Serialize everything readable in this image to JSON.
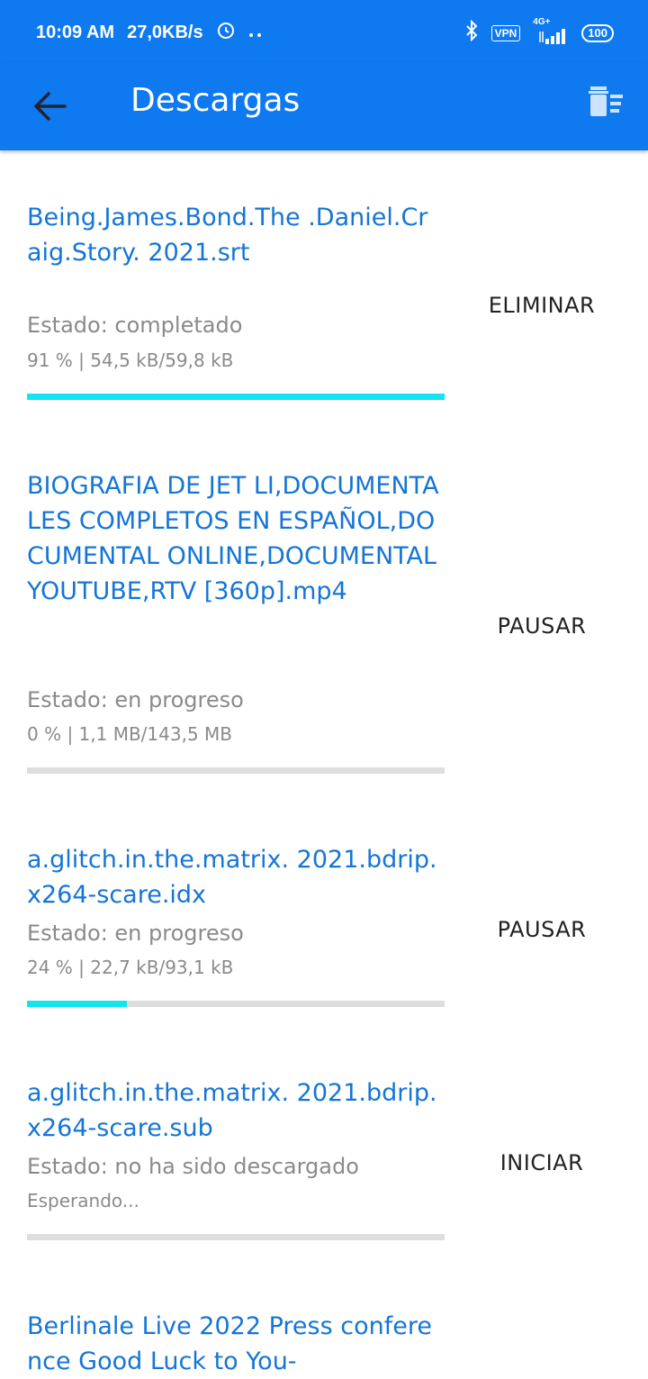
{
  "status_bar": {
    "time": "10:09 AM",
    "speed": "27,0KB/s",
    "vpn": "VPN",
    "network": "4G+",
    "battery": "100"
  },
  "app_bar": {
    "title": "Descargas"
  },
  "downloads": [
    {
      "name": "Being.James.Bond.The .Daniel.Craig.Story. 2021.srt",
      "status": "Estado: completado",
      "progress_text": "91 % | 54,5 kB/59,8 kB",
      "progress": 1.0,
      "action": "ELIMINAR"
    },
    {
      "name": "BIOGRAFIA DE JET LI,DOCUMENTALES COMPLETOS EN ESPAÑOL,DOCUMENTAL ONLINE,DOCUMENTAL YOUTUBE,RTV [360p].mp4",
      "status": "Estado: en progreso",
      "progress_text": "0 % | 1,1 MB/143,5 MB",
      "progress": 0.0,
      "action": "PAUSAR"
    },
    {
      "name": "a.glitch.in.the.matrix. 2021.bdrip.x264-scare.idx",
      "status": "Estado: en progreso",
      "progress_text": "24 % | 22,7 kB/93,1 kB",
      "progress": 0.24,
      "action": "PAUSAR"
    },
    {
      "name": "a.glitch.in.the.matrix. 2021.bdrip.x264-scare.sub",
      "status": "Estado: no ha sido descargado",
      "progress_text": "Esperando...",
      "progress": 0.0,
      "action": "INICIAR"
    },
    {
      "name": "Berlinale Live 2022 Press conference Good Luck to You-",
      "status": "",
      "progress_text": "",
      "progress": 0.0,
      "action": ""
    }
  ],
  "colors": {
    "primary": "#0f79f0",
    "title_text": "#1575d6",
    "progress": "#14e3f0",
    "track": "#dedede"
  }
}
